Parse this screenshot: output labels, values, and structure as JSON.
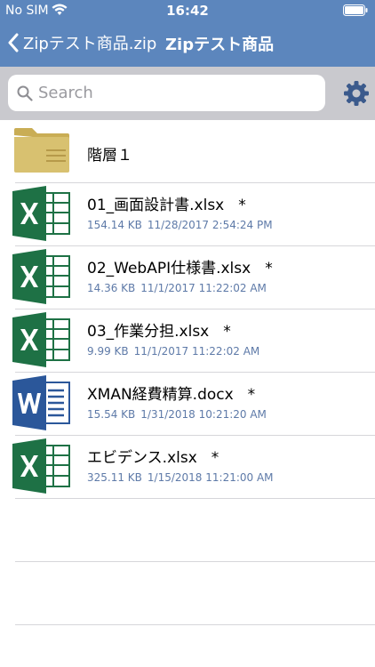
{
  "status": {
    "carrier": "No SIM",
    "time": "16:42"
  },
  "nav": {
    "back_label": "Zipテスト商品.zip",
    "title": "Zipテスト商品"
  },
  "search": {
    "placeholder": "Search"
  },
  "items": [
    {
      "type": "folder",
      "name": "階層１"
    },
    {
      "type": "excel",
      "name": "01_画面設計書.xlsx",
      "star": "*",
      "size": "154.14 KB",
      "date": "11/28/2017 2:54:24 PM"
    },
    {
      "type": "excel",
      "name": "02_WebAPI仕様書.xlsx",
      "star": "*",
      "size": "14.36 KB",
      "date": "11/1/2017 11:22:02 AM"
    },
    {
      "type": "excel",
      "name": "03_作業分担.xlsx",
      "star": "*",
      "size": "9.99 KB",
      "date": "11/1/2017 11:22:02 AM"
    },
    {
      "type": "word",
      "name": "XMAN経費精算.docx",
      "star": "*",
      "size": "15.54 KB",
      "date": "1/31/2018 10:21:20 AM"
    },
    {
      "type": "excel",
      "name": "エビデンス.xlsx",
      "star": "*",
      "size": "325.11 KB",
      "date": "1/15/2018 11:21:00 AM"
    }
  ],
  "colors": {
    "header": "#5c86bd",
    "searchbar_bg": "#c9c9ce",
    "meta_text": "#5e7aa8",
    "excel": "#1e7145",
    "word": "#2b579a",
    "folder": "#d8c170",
    "gear": "#3b5a8c"
  },
  "icons": {
    "back": "chevron-left-icon",
    "search": "magnifier-icon",
    "settings": "gear-icon",
    "wifi": "wifi-icon",
    "battery": "battery-icon"
  }
}
